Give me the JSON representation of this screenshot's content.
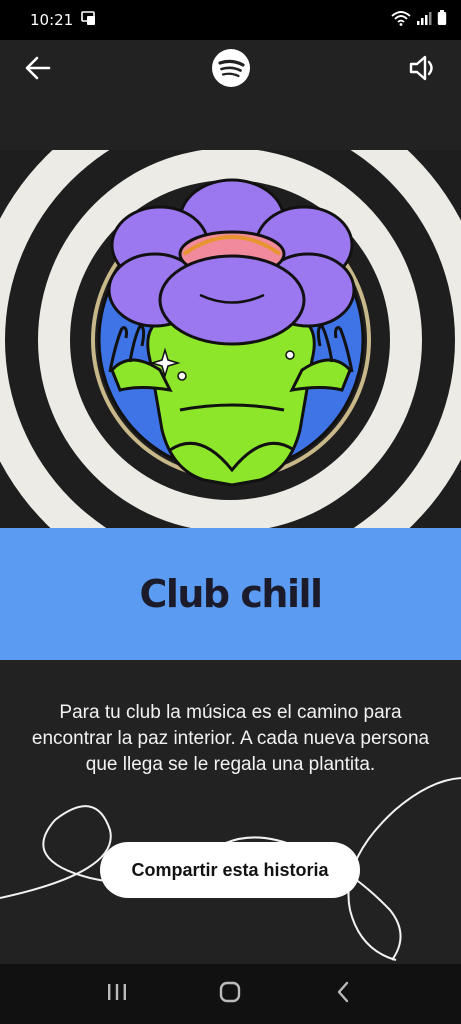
{
  "status_bar": {
    "time": "10:21",
    "icons": [
      "screen-mirror-icon",
      "wifi-icon",
      "signal-icon",
      "battery-icon"
    ]
  },
  "header": {
    "back_icon": "arrow-left-icon",
    "logo_icon": "spotify-logo-icon",
    "sound_icon": "speaker-icon"
  },
  "story": {
    "title": "Club chill",
    "description": "Para tu club la música es el camino para encontrar la paz interior. A cada nueva persona que llega se le regala una plantita.",
    "share_label": "Compartir esta historia"
  },
  "nav_bar": {
    "icons": [
      "recent-apps-icon",
      "home-icon",
      "back-nav-icon"
    ]
  },
  "colors": {
    "background": "#222222",
    "title_band": "#5b9cf2",
    "title_text": "#1b1b2b",
    "petal": "#9c78f0",
    "frog": "#8ee62a",
    "badge_bg": "#3f74e6",
    "center": "#f08a9c"
  }
}
